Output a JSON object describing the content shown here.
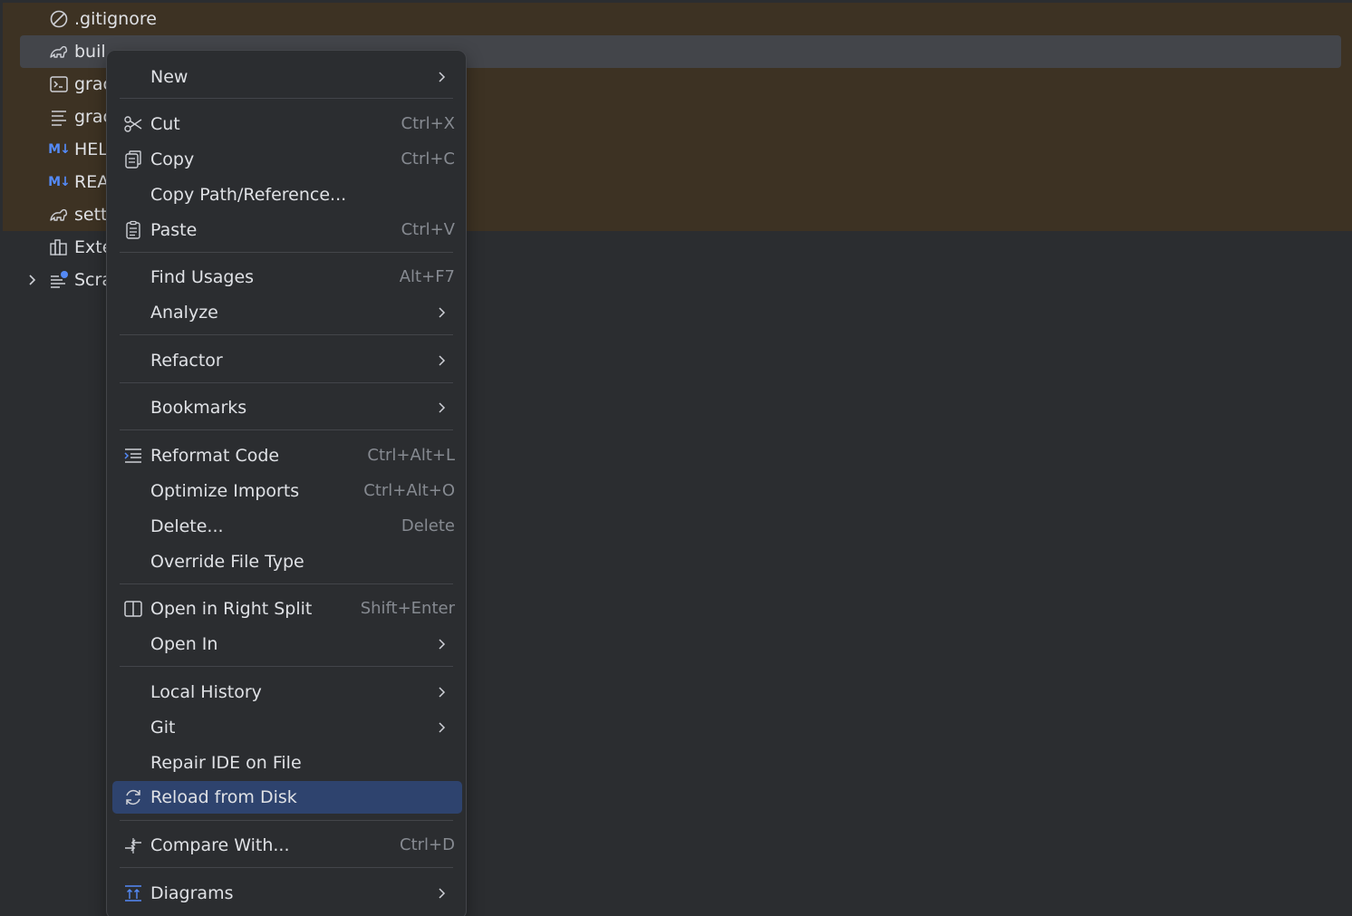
{
  "tree": {
    "items": [
      {
        "label": ".gitignore",
        "icon": "ignore-file-icon"
      },
      {
        "label": "buil",
        "icon": "gradle-elephant-icon"
      },
      {
        "label": "grac",
        "icon": "terminal-script-icon"
      },
      {
        "label": "grac",
        "icon": "properties-file-icon"
      },
      {
        "label": "HEL",
        "icon": "markdown-icon",
        "icon_text": "M↓"
      },
      {
        "label": "REA",
        "icon": "markdown-icon",
        "icon_text": "M↓"
      },
      {
        "label": "sett",
        "icon": "gradle-elephant-icon"
      },
      {
        "label": "Exte",
        "icon": "external-libraries-icon"
      },
      {
        "label": "Scra",
        "icon": "scratches-icon"
      }
    ],
    "selected_index": 1
  },
  "menu": {
    "new": {
      "label": "New"
    },
    "cut": {
      "label": "Cut",
      "shortcut": "Ctrl+X"
    },
    "copy": {
      "label": "Copy",
      "shortcut": "Ctrl+C"
    },
    "copy_path": {
      "label": "Copy Path/Reference..."
    },
    "paste": {
      "label": "Paste",
      "shortcut": "Ctrl+V"
    },
    "find_usages": {
      "label": "Find Usages",
      "shortcut": "Alt+F7"
    },
    "analyze": {
      "label": "Analyze"
    },
    "refactor": {
      "label": "Refactor"
    },
    "bookmarks": {
      "label": "Bookmarks"
    },
    "reformat": {
      "label": "Reformat Code",
      "shortcut": "Ctrl+Alt+L"
    },
    "optimize": {
      "label": "Optimize Imports",
      "shortcut": "Ctrl+Alt+O"
    },
    "delete": {
      "label": "Delete...",
      "shortcut": "Delete"
    },
    "override": {
      "label": "Override File Type"
    },
    "open_split": {
      "label": "Open in Right Split",
      "shortcut": "Shift+Enter"
    },
    "open_in": {
      "label": "Open In"
    },
    "local_history": {
      "label": "Local History"
    },
    "git": {
      "label": "Git"
    },
    "repair": {
      "label": "Repair IDE on File"
    },
    "reload": {
      "label": "Reload from Disk"
    },
    "compare": {
      "label": "Compare With...",
      "shortcut": "Ctrl+D"
    },
    "diagrams": {
      "label": "Diagrams"
    }
  },
  "colors": {
    "background": "#2b2d30",
    "excluded_background": "#3d3223",
    "selection": "#2e436e",
    "tree_selection": "#43454a",
    "text": "#dfe1e5",
    "shortcut_text": "#868a91",
    "markdown_accent": "#548af7"
  }
}
